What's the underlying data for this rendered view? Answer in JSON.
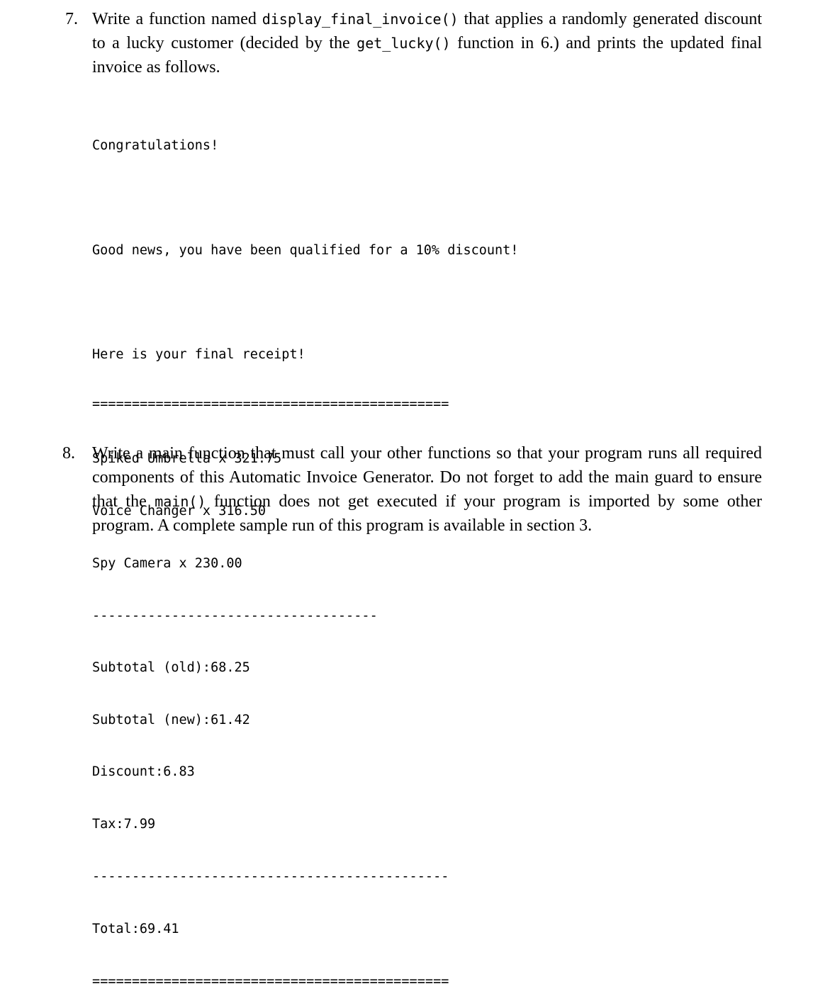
{
  "item7": {
    "number": "7.",
    "text_before": "Write a function named ",
    "func1": "display_final_invoice()",
    "text_mid": " that applies a randomly generated discount to a lucky customer (decided by the ",
    "func2": "get_lucky()",
    "text_after": " function in 6.) and prints the updated final invoice as follows."
  },
  "output": {
    "congrats": "Congratulations!",
    "good_news": "Good news, you have been qualified for a 10% discount!",
    "here": "Here is your final receipt!",
    "double_sep": "=============================================",
    "short_dash": "------------------------------------",
    "long_dash": "---------------------------------------------",
    "items": [
      {
        "label": "Spiked Umbrella x 3",
        "value": "21.75"
      },
      {
        "label": "Voice Changer x 3",
        "value": "16.50"
      },
      {
        "label": "Spy Camera x 2",
        "value": "30.00"
      }
    ],
    "summary": [
      {
        "label": "Subtotal (old):",
        "value": "68.25"
      },
      {
        "label": "Subtotal (new):",
        "value": "61.42"
      },
      {
        "label": "Discount:",
        "value": "6.83"
      },
      {
        "label": "Tax:",
        "value": "7.99"
      }
    ],
    "total": {
      "label": "Total:",
      "value": "69.41"
    }
  },
  "item8": {
    "number": "8.",
    "text_before": "Write a main function that must call your other functions so that your program runs all required components of this Automatic Invoice Generator. Do not forget to add the main guard to ensure that the ",
    "func": "main()",
    "text_after": " function does not get executed if your program is imported by some other program. A complete sample run of this program is available in section 3."
  }
}
